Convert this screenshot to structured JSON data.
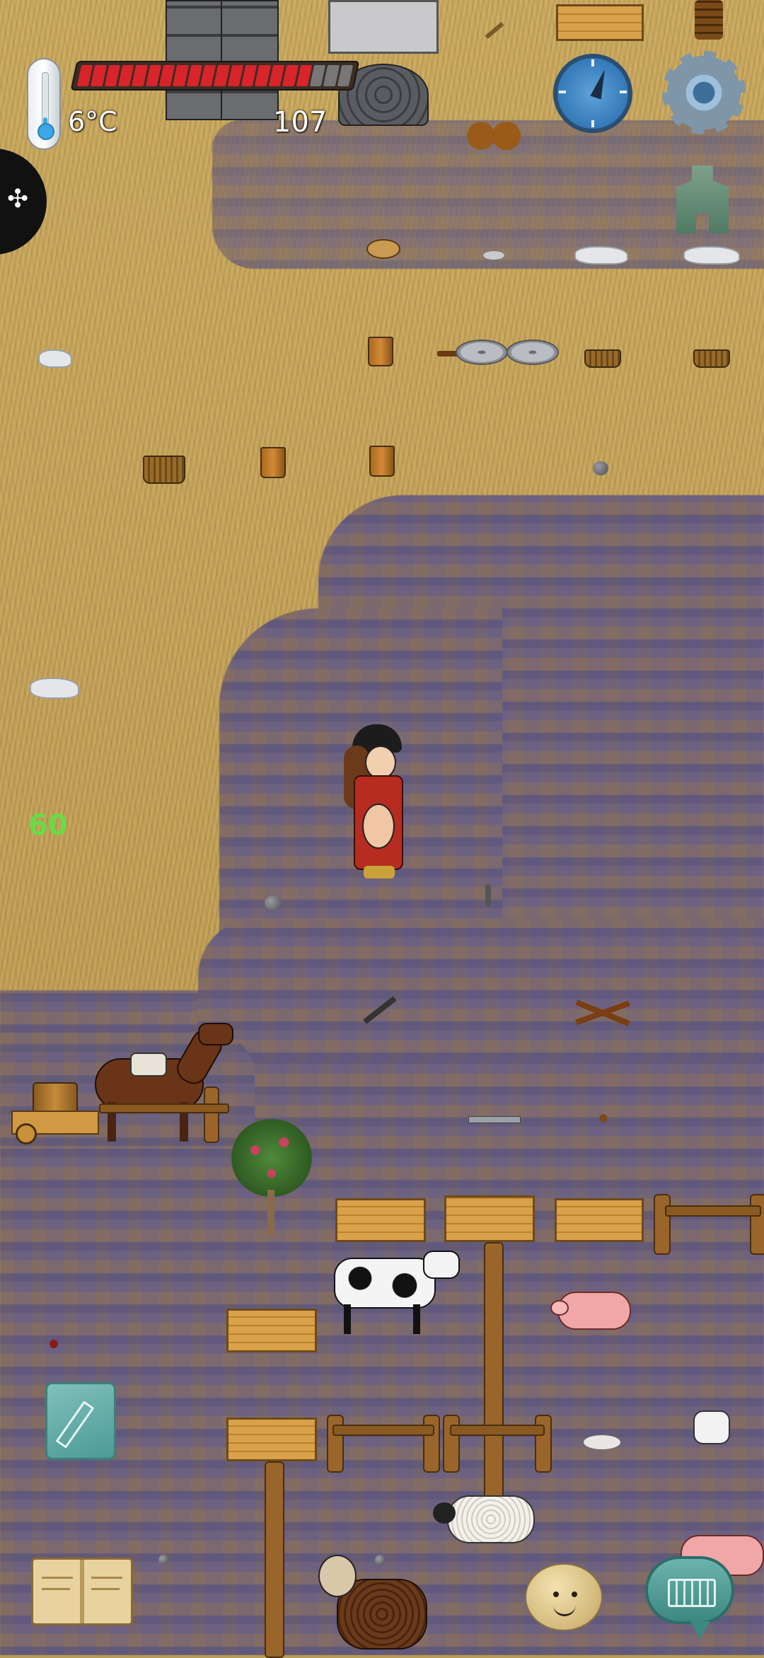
{
  "hud": {
    "temperature": "6°C",
    "yum_counter": "107",
    "fps": "60",
    "food_segments_filled": 17,
    "food_segments_total": 20
  },
  "icons": {
    "thermometer": "thermometer-icon",
    "compass": "compass-icon",
    "settings": "gear-icon",
    "coin": "coin-icon",
    "puzzle": "puzzle-icon",
    "note": "pencil-icon",
    "book": "book-icon",
    "emote": "face-icon",
    "chat": "keyboard-icon"
  },
  "colors": {
    "food_full": "#d8242a",
    "food_empty": "#777777",
    "fps": "#66dd44",
    "chat_button": "#3e8882"
  }
}
